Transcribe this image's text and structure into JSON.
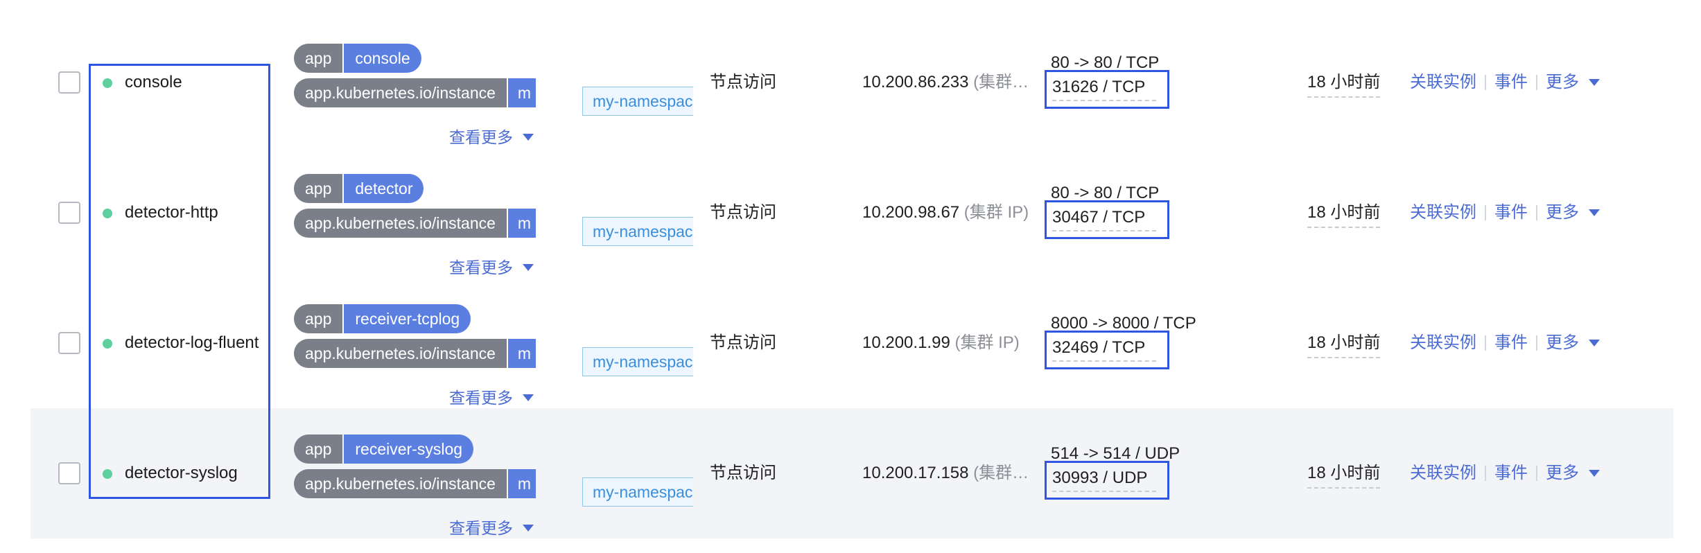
{
  "more_label": "查看更多",
  "actions": {
    "link_instances": "关联实例",
    "events": "事件",
    "more": "更多"
  },
  "rows": [
    {
      "name": "console",
      "tag_key": "app",
      "tag_val": "console",
      "tag2_key": "app.kubernetes.io/instance",
      "tag2_val": "m",
      "namespace": "my-namespace",
      "svc_type": "节点访问",
      "ip": "10.200.86.233",
      "ip_suffix": " (集群…",
      "port_map": "80 -> 80 / TCP",
      "nodeport": "31626 / TCP",
      "age": "18 小时前"
    },
    {
      "name": "detector-http",
      "tag_key": "app",
      "tag_val": "detector",
      "tag2_key": "app.kubernetes.io/instance",
      "tag2_val": "m",
      "namespace": "my-namespace",
      "svc_type": "节点访问",
      "ip": "10.200.98.67",
      "ip_suffix": " (集群 IP)",
      "port_map": "80 -> 80 / TCP",
      "nodeport": "30467 / TCP",
      "age": "18 小时前"
    },
    {
      "name": "detector-log-fluent",
      "tag_key": "app",
      "tag_val": "receiver-tcplog",
      "tag2_key": "app.kubernetes.io/instance",
      "tag2_val": "m",
      "namespace": "my-namespace",
      "svc_type": "节点访问",
      "ip": "10.200.1.99",
      "ip_suffix": " (集群 IP)",
      "port_map": "8000 -> 8000 / TCP",
      "nodeport": "32469 / TCP",
      "age": "18 小时前"
    },
    {
      "name": "detector-syslog",
      "tag_key": "app",
      "tag_val": "receiver-syslog",
      "tag2_key": "app.kubernetes.io/instance",
      "tag2_val": "m",
      "namespace": "my-namespace",
      "svc_type": "节点访问",
      "ip": "10.200.17.158",
      "ip_suffix": " (集群…",
      "port_map": "514 -> 514 / UDP",
      "nodeport": "30993 / UDP",
      "age": "18 小时前"
    }
  ],
  "colors": {
    "accent": "#4a6bd4",
    "tag_gray": "#7a7f8a",
    "tag_blue": "#5b7fe0",
    "status_green": "#5fcf9f",
    "highlight_box": "#2f56e0",
    "row_highlight": "#f3f4f8"
  }
}
